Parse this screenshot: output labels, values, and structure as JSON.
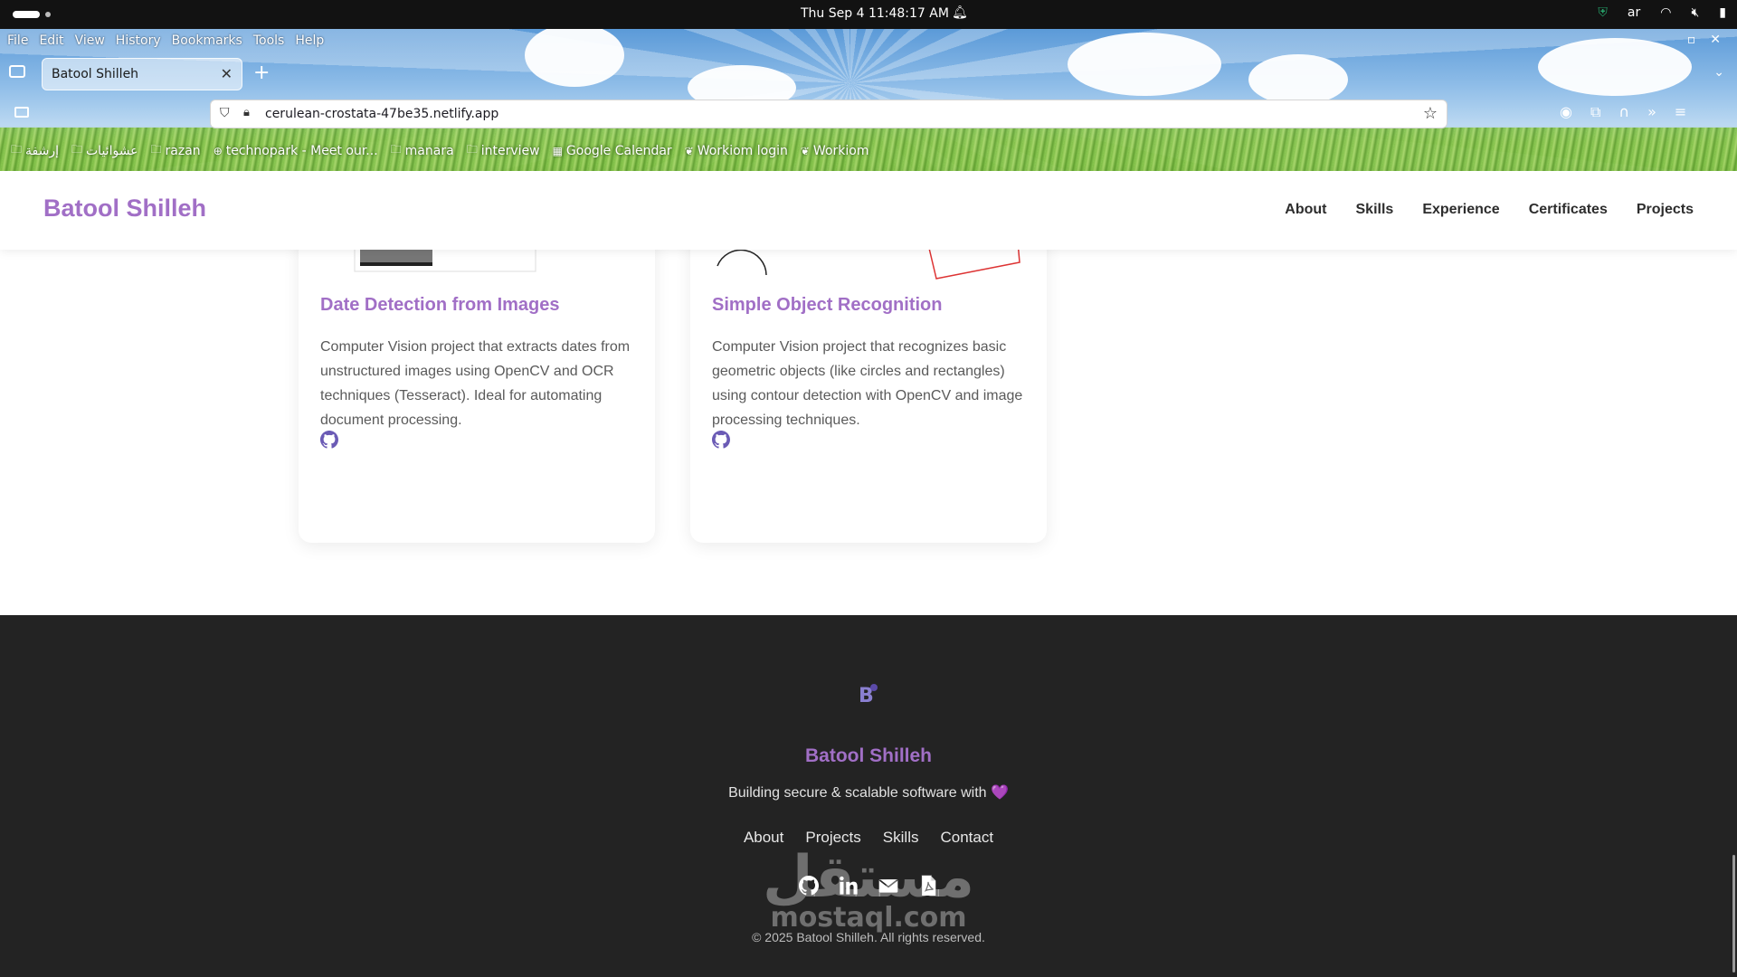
{
  "os_bar": {
    "clock": "Thu Sep 4  11:48:17 AM",
    "language": "ar"
  },
  "browser": {
    "menu": [
      "File",
      "Edit",
      "View",
      "History",
      "Bookmarks",
      "Tools",
      "Help"
    ],
    "tab_title": "Batool Shilleh",
    "url": "cerulean-crostata-47be35.netlify.app",
    "bookmarks": [
      "إرشفة",
      "عشوائيات",
      "razan",
      "technopark - Meet our...",
      "manara",
      "interview",
      "Google Calendar",
      "Workiom login",
      "Workiom"
    ]
  },
  "site": {
    "brand": "Batool Shilleh",
    "nav": [
      "About",
      "Skills",
      "Experience",
      "Certificates",
      "Projects"
    ]
  },
  "projects": [
    {
      "title": "Date Detection from Images",
      "description": "Computer Vision project that extracts dates from unstructured images using OpenCV and OCR techniques (Tesseract). Ideal for automating document processing."
    },
    {
      "title": "Simple Object Recognition",
      "description": "Computer Vision project that recognizes basic geometric objects (like circles and rectangles) using contour detection with OpenCV and image processing techniques."
    }
  ],
  "footer": {
    "name": "Batool Shilleh",
    "tagline": "Building secure & scalable software with 💜",
    "links": [
      "About",
      "Projects",
      "Skills",
      "Contact"
    ],
    "copyright": "© 2025 Batool Shilleh. All rights reserved."
  },
  "watermark": {
    "arabic": "مستقل",
    "latin": "mostaql.com"
  },
  "colors": {
    "accent": "#a16fc6",
    "footer_bg": "#232323",
    "icon_purple": "#6b5bb5"
  }
}
